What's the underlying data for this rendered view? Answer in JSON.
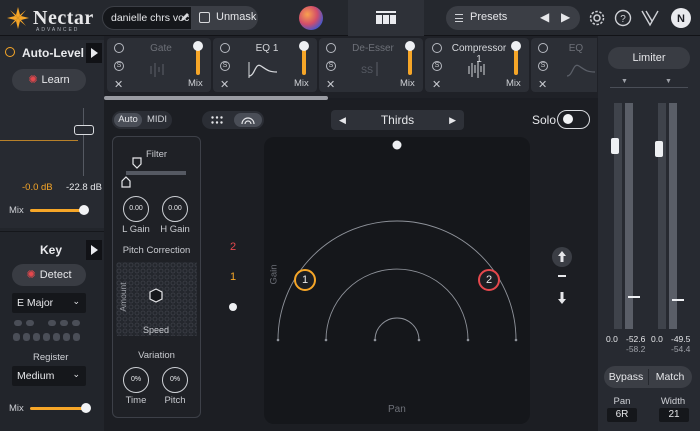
{
  "app": {
    "name": "Nectar",
    "edition": "ADVANCED"
  },
  "topbar": {
    "preset_name": "danielle chrs voc",
    "unmask_label": "Unmask",
    "presets_label": "Presets",
    "prev_arrow": "◀",
    "next_arrow": "▶",
    "icons": [
      "nectar-orb-icon",
      "module-grid-icon",
      "settings-gear-icon",
      "help-icon",
      "ni-logo-icon"
    ]
  },
  "modules": [
    {
      "name": "Gate",
      "mix_label": "Mix",
      "active": false
    },
    {
      "name": "EQ 1",
      "mix_label": "Mix",
      "active": true
    },
    {
      "name": "De-Esser",
      "mix_label": "Mix",
      "active": false
    },
    {
      "name": "Compressor 1",
      "mix_label": "Mix",
      "active": true
    },
    {
      "name": "EQ",
      "mix_label": "",
      "active": false
    }
  ],
  "left": {
    "autolevel": {
      "title": "Auto-Level",
      "learn_label": "Learn",
      "left_value": "-0.0 dB",
      "right_value": "-22.8 dB",
      "mix_label": "Mix",
      "mix_value": 0.85
    },
    "key": {
      "title": "Key",
      "detect_label": "Detect",
      "key_value": "E Major",
      "register_label": "Register",
      "register_value": "Medium",
      "mix_label": "Mix",
      "mix_value": 0.88
    }
  },
  "center": {
    "mode_auto": "Auto",
    "mode_midi": "MIDI",
    "voicing": "Thirds",
    "solo_label": "Solo",
    "filter_label": "Filter",
    "l_gain_label": "L Gain",
    "l_gain_value": "0.00",
    "h_gain_label": "H Gain",
    "h_gain_value": "0.00",
    "pitch_correction_label": "Pitch Correction",
    "amount_label": "Amount",
    "speed_label": "Speed",
    "variation_label": "Variation",
    "time_label": "Time",
    "time_value": "0%",
    "pitch_label": "Pitch",
    "pitch_value": "0%",
    "voice_indicators": [
      "2",
      "1"
    ],
    "gain_axis": "Gain",
    "pan_axis": "Pan",
    "nodes": [
      "1",
      "2"
    ]
  },
  "right": {
    "limiter_label": "Limiter",
    "meter_left_top": "0.0",
    "meter_left_peak": "-52.6",
    "meter_left_rms": "-58.2",
    "meter_right_top": "0.0",
    "meter_right_peak": "-49.5",
    "meter_right_rms": "-54.4",
    "bypass_label": "Bypass",
    "match_label": "Match",
    "pan_label": "Pan",
    "pan_value": "6R",
    "width_label": "Width",
    "width_value": "21"
  },
  "colors": {
    "accent": "#f6a628",
    "node1": "#f6a628",
    "node2": "#e5484d",
    "red_indicator": "#e5484d"
  }
}
